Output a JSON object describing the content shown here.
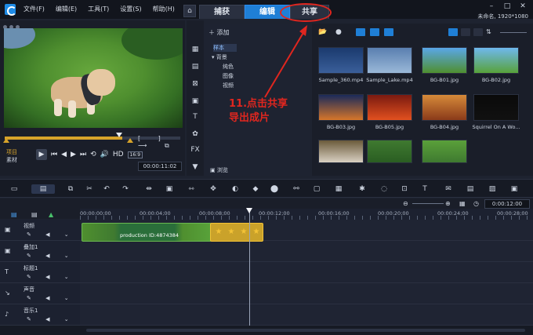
{
  "menu": [
    "文件(F)",
    "编辑(E)",
    "工具(T)",
    "设置(S)",
    "帮助(H)"
  ],
  "tabs": [
    "捕获",
    "编辑",
    "共享"
  ],
  "active_tab": "编辑",
  "project_info": "未命名, 1920*1080",
  "player": {
    "mode_project": "项目",
    "mode_clip": "素材",
    "hd_label": "HD",
    "ratio_label": "16:9",
    "timecode": "00:00:11:02"
  },
  "library": {
    "add_label": "添加",
    "browse_label": "浏览",
    "tree": [
      "样本",
      "背景",
      "纯色",
      "图像",
      "视频"
    ],
    "thumbs": [
      {
        "label": "Sample_360.mp4",
        "color_top": "#1b3a6e",
        "color_bottom": "#3a5f9a"
      },
      {
        "label": "Sample_Lake.mp4",
        "color_top": "#5a7fb0",
        "color_bottom": "#9ab8d8"
      },
      {
        "label": "BG-B01.jpg",
        "color_top": "#5aa7e8",
        "color_bottom": "#4f8f2f"
      },
      {
        "label": "BG-B02.jpg",
        "color_top": "#6fb8ee",
        "color_bottom": "#58a23a"
      },
      {
        "label": "BG-B03.jpg",
        "color_top": "#1a2a5a",
        "color_bottom": "#d6762a"
      },
      {
        "label": "BG-B05.jpg",
        "color_top": "#7a1a10",
        "color_bottom": "#e2501f"
      },
      {
        "label": "BG-B04.jpg",
        "color_top": "#d68a3a",
        "color_bottom": "#8a3a1a"
      },
      {
        "label": "Squirrel On A Wo...",
        "color_top": "#0a0a0a",
        "color_bottom": "#111111"
      },
      {
        "label": "",
        "color_top": "#6a5a3a",
        "color_bottom": "#d9d0c2"
      },
      {
        "label": "",
        "color_top": "#3f7a30",
        "color_bottom": "#2a5e22"
      },
      {
        "label": "",
        "color_top": "#5aa03a",
        "color_bottom": "#3f7a30"
      }
    ]
  },
  "annotation": {
    "line1": "11.点击共享",
    "line2": "导出成片",
    "color": "#e0261f"
  },
  "timeline": {
    "timecode": "0:00:12:00",
    "ruler": [
      "00:00:00;00",
      "00:00:04;00",
      "00:00:08;00",
      "00:00:12;00",
      "00:00:16;00",
      "00:00:20;00",
      "00:00:24;00",
      "00:00:28;00"
    ],
    "tracks": [
      "视频",
      "叠加1",
      "标题1",
      "声音",
      "音乐1"
    ],
    "clip_title": "production ID:4874384"
  }
}
